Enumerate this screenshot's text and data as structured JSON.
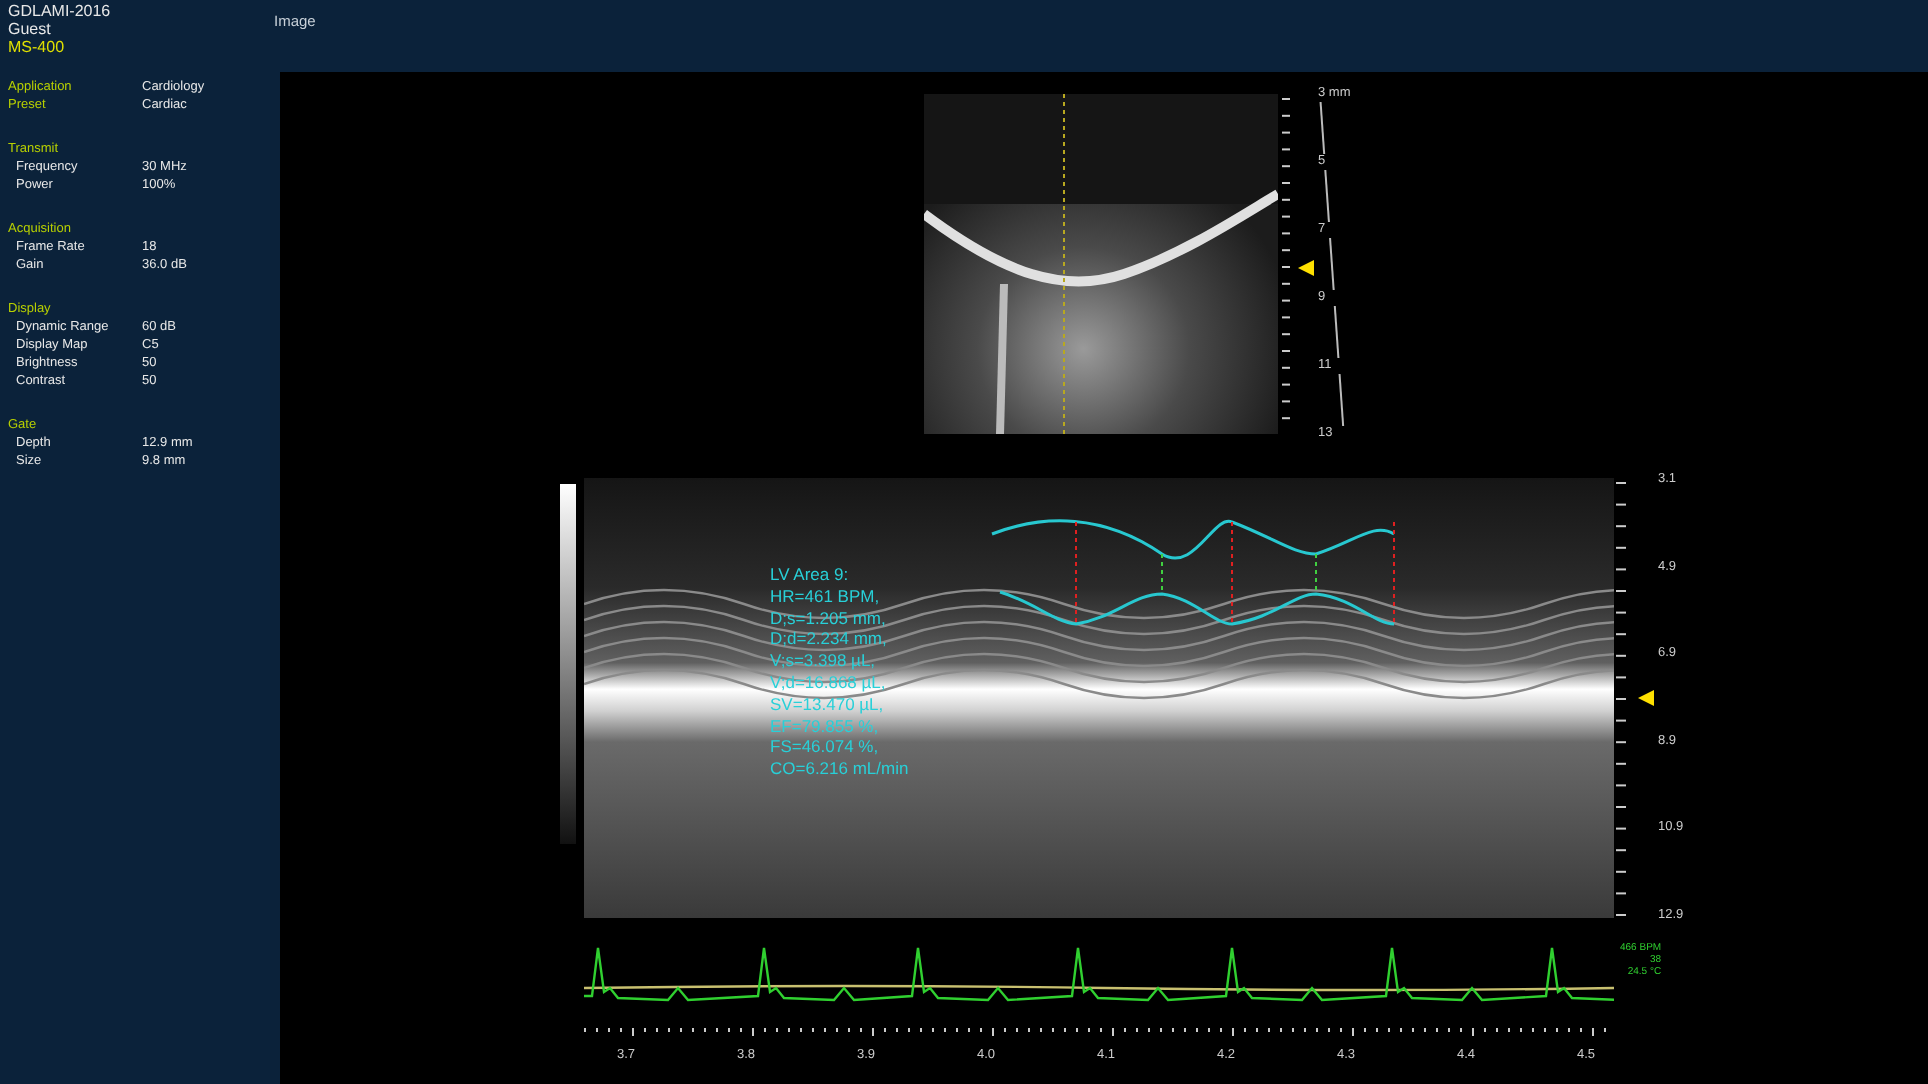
{
  "header": {
    "study": "GDLAMI-2016",
    "user": "Guest",
    "system": "MS-400"
  },
  "panel_title": "Image",
  "top_settings": [
    {
      "label": "Application",
      "value": "Cardiology"
    },
    {
      "label": "Preset",
      "value": "Cardiac"
    }
  ],
  "groups": [
    {
      "title": "Transmit",
      "items": [
        {
          "label": "Frequency",
          "value": "30 MHz"
        },
        {
          "label": "Power",
          "value": "100%"
        }
      ]
    },
    {
      "title": "Acquisition",
      "items": [
        {
          "label": "Frame Rate",
          "value": "18"
        },
        {
          "label": "Gain",
          "value": "36.0 dB"
        }
      ]
    },
    {
      "title": "Display",
      "items": [
        {
          "label": "Dynamic Range",
          "value": "60 dB"
        },
        {
          "label": "Display Map",
          "value": "C5"
        },
        {
          "label": "Brightness",
          "value": "50"
        },
        {
          "label": "Contrast",
          "value": "50"
        }
      ]
    },
    {
      "title": "Gate",
      "items": [
        {
          "label": "Depth",
          "value": "12.9 mm"
        },
        {
          "label": "Size",
          "value": "9.8 mm"
        }
      ]
    }
  ],
  "b_mode": {
    "depth_labels": [
      "3 mm",
      "5",
      "7",
      "9",
      "11",
      "13"
    ]
  },
  "m_mode": {
    "depth_labels": [
      "3.1",
      "4.9",
      "6.9",
      "8.9",
      "10.9",
      "12.9"
    ],
    "measurement": [
      "LV Area 9:",
      "HR=461 BPM,",
      "D;s=1.205 mm,",
      "D;d=2.234 mm,",
      "V;s=3.398 µL,",
      "V;d=16.868 µL,",
      "SV=13.470 µL,",
      "EF=79.855 %,",
      "FS=46.074 %,",
      "CO=6.216 mL/min"
    ]
  },
  "ecg": {
    "readouts": [
      "466 BPM",
      "38",
      "24.5 °C"
    ]
  },
  "time_axis": {
    "labels": [
      "3.7",
      "3.8",
      "3.9",
      "4.0",
      "4.1",
      "4.2",
      "4.3",
      "4.4",
      "4.5"
    ]
  }
}
